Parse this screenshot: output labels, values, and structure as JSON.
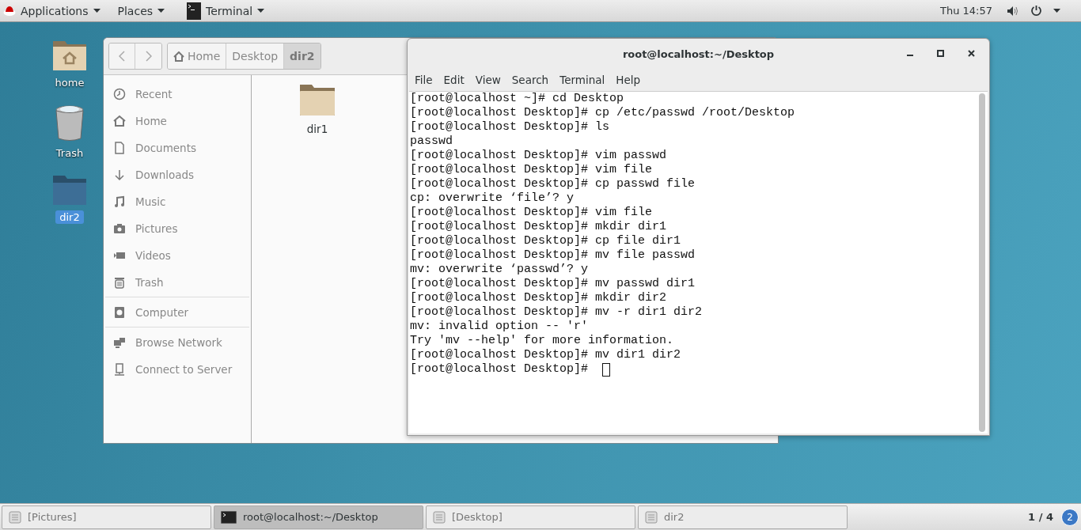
{
  "top_bar": {
    "menus": [
      {
        "label": "Applications"
      },
      {
        "label": "Places"
      },
      {
        "label": "Terminal"
      }
    ],
    "clock": "Thu 14:57"
  },
  "desktop_icons": [
    {
      "label": "home",
      "selected": false
    },
    {
      "label": "Trash",
      "selected": false
    },
    {
      "label": "dir2",
      "selected": true
    }
  ],
  "file_manager": {
    "breadcrumbs": [
      {
        "label": "Home",
        "selected": false
      },
      {
        "label": "Desktop",
        "selected": false
      },
      {
        "label": "dir2",
        "selected": true
      }
    ],
    "sidebar": [
      [
        {
          "label": "Recent"
        },
        {
          "label": "Home"
        },
        {
          "label": "Documents"
        },
        {
          "label": "Downloads"
        },
        {
          "label": "Music"
        },
        {
          "label": "Pictures"
        },
        {
          "label": "Videos"
        },
        {
          "label": "Trash"
        }
      ],
      [
        {
          "label": "Computer"
        }
      ],
      [
        {
          "label": "Browse Network"
        },
        {
          "label": "Connect to Server"
        }
      ]
    ],
    "files": [
      {
        "name": "dir1"
      }
    ]
  },
  "terminal": {
    "title": "root@localhost:~/Desktop",
    "menu": [
      "File",
      "Edit",
      "View",
      "Search",
      "Terminal",
      "Help"
    ],
    "lines": [
      "[root@localhost ~]# cd Desktop",
      "[root@localhost Desktop]# cp /etc/passwd /root/Desktop",
      "[root@localhost Desktop]# ls",
      "passwd",
      "[root@localhost Desktop]# vim passwd",
      "[root@localhost Desktop]# vim file",
      "[root@localhost Desktop]# cp passwd file",
      "cp: overwrite ‘file’? y",
      "[root@localhost Desktop]# vim file",
      "[root@localhost Desktop]# mkdir dir1",
      "[root@localhost Desktop]# cp file dir1",
      "[root@localhost Desktop]# mv file passwd",
      "mv: overwrite ‘passwd’? y",
      "[root@localhost Desktop]# mv passwd dir1",
      "[root@localhost Desktop]# mkdir dir2",
      "[root@localhost Desktop]# mv -r dir1 dir2",
      "mv: invalid option -- 'r'",
      "Try 'mv --help' for more information.",
      "[root@localhost Desktop]# mv dir1 dir2",
      "[root@localhost Desktop]# "
    ]
  },
  "taskbar": {
    "items": [
      {
        "label": "[Pictures]",
        "selected": false
      },
      {
        "label": "root@localhost:~/Desktop",
        "selected": true
      },
      {
        "label": "[Desktop]",
        "selected": false
      },
      {
        "label": "dir2",
        "selected": false
      }
    ],
    "workspace": "1 / 4",
    "badge": "2"
  }
}
